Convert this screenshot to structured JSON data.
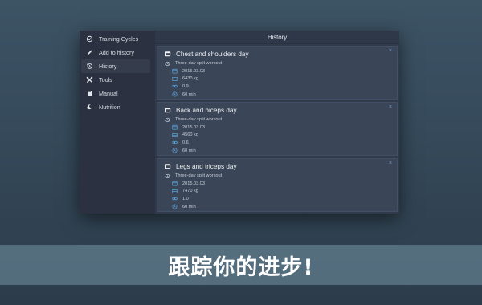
{
  "sidebar": {
    "items": [
      {
        "label": "Training Cycles",
        "icon": "training-cycles-icon"
      },
      {
        "label": "Add to history",
        "icon": "pencil-icon"
      },
      {
        "label": "History",
        "icon": "history-icon",
        "active": true
      },
      {
        "label": "Tools",
        "icon": "tools-icon"
      },
      {
        "label": "Manual",
        "icon": "manual-icon"
      },
      {
        "label": "Nutrition",
        "icon": "nutrition-icon"
      }
    ]
  },
  "header": {
    "title": "History"
  },
  "cards": [
    {
      "title": "Chest and shoulders day",
      "plan": "Three-day split workout",
      "date": "2015.03.03",
      "weight": "6430 kg",
      "intensity": "0.9",
      "duration": "60 min",
      "close": "×"
    },
    {
      "title": "Back and biceps day",
      "plan": "Three-day split workout",
      "date": "2015.03.03",
      "weight": "4560 kg",
      "intensity": "0.6",
      "duration": "60 min",
      "close": "×"
    },
    {
      "title": "Legs and triceps day",
      "plan": "Three-day split workout",
      "date": "2015.03.03",
      "weight": "7470 kg",
      "intensity": "1.0",
      "duration": "60 min",
      "close": "×"
    }
  ],
  "banner": {
    "text": "跟踪你的进步!"
  },
  "colors": {
    "accent": "#5aa7e0",
    "background": "#3d5465",
    "window": "#2a3342"
  }
}
